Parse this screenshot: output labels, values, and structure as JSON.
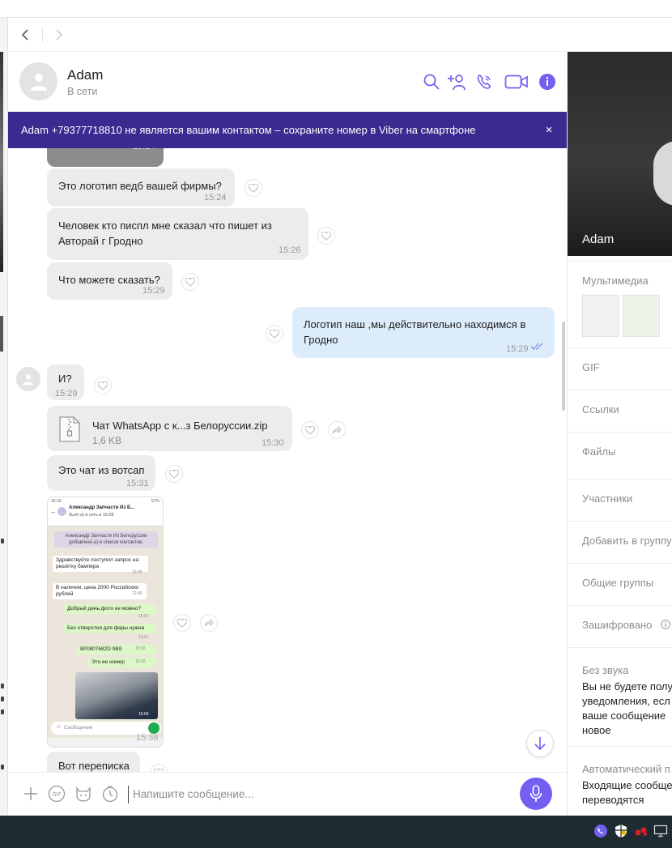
{
  "colors": {
    "accent": "#7360f2",
    "banner_bg": "#3b2a8f",
    "bubble_in": "#ececec",
    "bubble_out": "#ddecfa",
    "taskbar": "#1e2b33"
  },
  "header": {
    "name": "Adam",
    "status": "В сети",
    "icons": [
      "search-icon",
      "add-contact-icon",
      "call-icon",
      "video-icon",
      "info-icon"
    ]
  },
  "banner": {
    "text": "Adam +79377718810 не является вашим контактом – сохраните номер в Viber на смартфоне",
    "close": "×"
  },
  "messages": [
    {
      "text": "",
      "time": "15:24"
    },
    {
      "text": "Это логотип ведб вашей фирмы?",
      "time": "15:24"
    },
    {
      "line1": "Человек кто писпл мне сказал что пишет из",
      "line2": "Авторай г Гродно",
      "time": "15:26"
    },
    {
      "text": "Что можете сказать?",
      "time": "15:29"
    },
    {
      "line1": "Логотип наш ,мы действительно находимся в",
      "line2": "Гродно",
      "time": "15:29"
    },
    {
      "text": "И?",
      "time": "15:29"
    },
    {
      "file_name": "Чат WhatsApp с к...з Белоруссии.zip",
      "file_size": "1,6 KB",
      "time": "15:30"
    },
    {
      "text": "Это чат из вотсап",
      "time": "15:31"
    },
    {
      "time": "15:38"
    },
    {
      "text": "Вот переписка"
    }
  ],
  "screenshot": {
    "status_time": "15:10",
    "battery": "57%",
    "contact": "Александр Запчасти Из Б...",
    "seen": "был(-а) в сеть в 16:09",
    "system_note": "Александр Запчасти Из Белоруссии добавлен(-а) в список контактов.",
    "msgs": [
      {
        "text": "Здравствуйте поступил запрос на решётку бампера",
        "time": "12:09"
      },
      {
        "text": "В наличии, цена 2000 Российских рублей",
        "time": "12:59"
      },
      {
        "text": "Добрый день,фото ее можно?",
        "time": "15:01"
      },
      {
        "text": "Без отверстия для фары нужна",
        "time": "15:01"
      },
      {
        "text": "8P0807682D 9B9",
        "time": "15:02"
      },
      {
        "text": "Это ее номер",
        "time": "15:02"
      }
    ],
    "photo_time": "15:04",
    "composer_placeholder": "Сообщение"
  },
  "composer": {
    "placeholder": "Напишите сообщение..."
  },
  "info_panel": {
    "name": "Adam",
    "multimedia": "Мультимедиа",
    "gif": "GIF",
    "links": "Ссылки",
    "files": "Файлы",
    "participants": "Участники",
    "add_to_group": "Добавить в группу",
    "common_groups": "Общие группы",
    "encrypted": "Зашифровано",
    "mute_title": "Без звука",
    "mute_desc_lines": [
      "Вы не будете полу",
      "уведомления, есл",
      "ваше сообщение",
      "новое"
    ],
    "auto_title": "Автоматический п",
    "auto_desc_lines": [
      "Входящие сообще",
      "переводятся"
    ]
  },
  "left_marks": [
    "и",
    "в",
    "е"
  ]
}
